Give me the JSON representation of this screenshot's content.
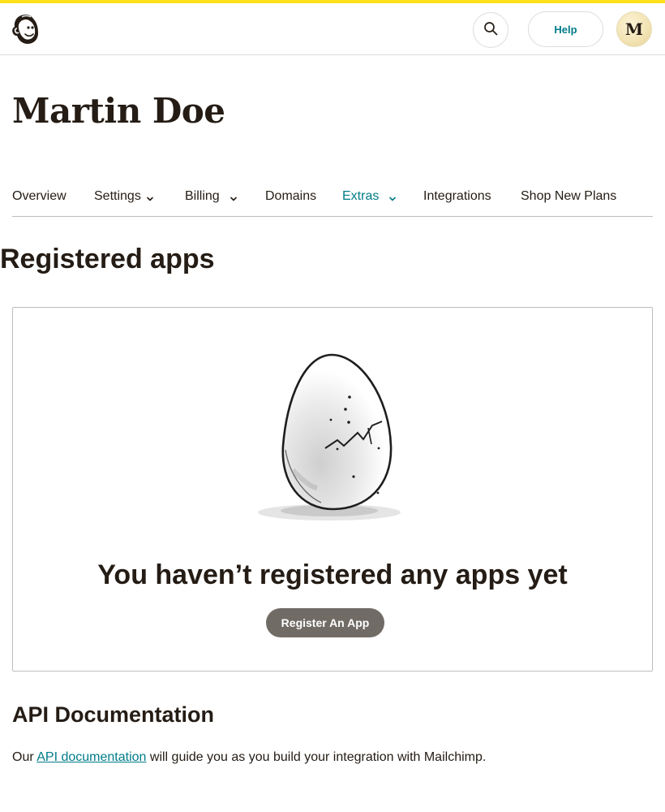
{
  "header": {
    "logo_icon": "mailchimp-freddie-icon",
    "search_icon": "search-icon",
    "help_label": "Help",
    "avatar_initial": "M"
  },
  "page": {
    "title": "Martin Doe"
  },
  "tabs": [
    {
      "label": "Overview",
      "has_dropdown": false,
      "active": false
    },
    {
      "label": "Settings",
      "has_dropdown": true,
      "active": false
    },
    {
      "label": "Billing",
      "has_dropdown": true,
      "active": false
    },
    {
      "label": "Domains",
      "has_dropdown": false,
      "active": false
    },
    {
      "label": "Extras",
      "has_dropdown": true,
      "active": true
    },
    {
      "label": "Integrations",
      "has_dropdown": false,
      "active": false
    },
    {
      "label": "Shop New Plans",
      "has_dropdown": false,
      "active": false
    }
  ],
  "registered_apps": {
    "title": "Registered apps",
    "empty_illustration": "cracked-egg-illustration",
    "empty_heading": "You haven’t registered any apps yet",
    "register_button": "Register An App"
  },
  "api_docs": {
    "title": "API Documentation",
    "text_before": "Our ",
    "link_text": "API documentation",
    "text_after": " will guide you as you build your integration with Mailchimp."
  },
  "colors": {
    "accent_yellow": "#ffe01b",
    "link_teal": "#007c89",
    "text_dark": "#241c15",
    "button_gray": "#716b66"
  }
}
